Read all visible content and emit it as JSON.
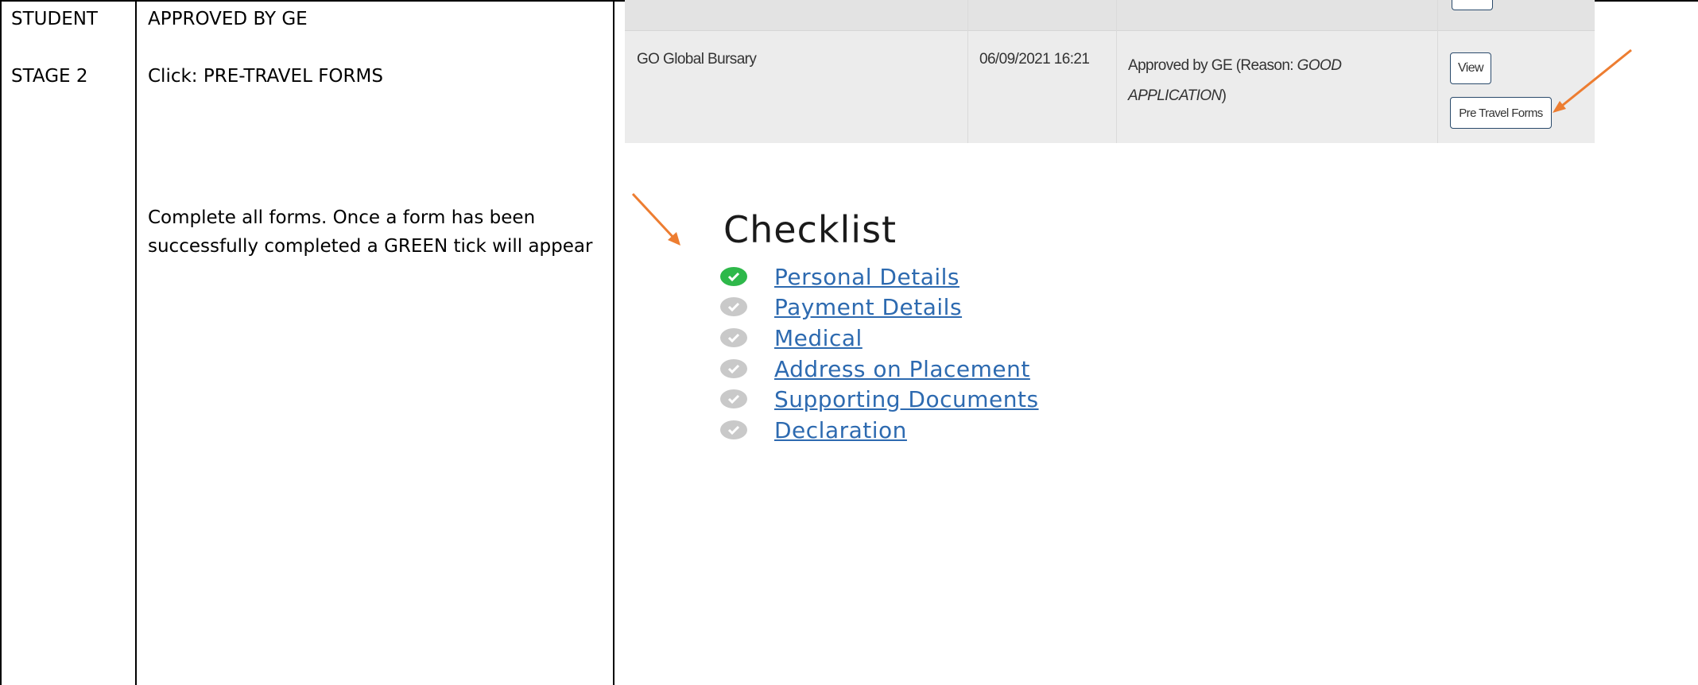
{
  "left_column": {
    "row1_label": "STUDENT",
    "row2_label": "STAGE 2"
  },
  "middle_column": {
    "row1_text": "APPROVED BY GE",
    "row2_text": "Click: PRE-TRAVEL FORMS",
    "instruction": "Complete all forms.  Once a form has been successfully completed a GREEN tick will appear"
  },
  "application_row": {
    "name": "GO Global Bursary",
    "datetime": "06/09/2021 16:21",
    "status_prefix": "Approved by GE (Reason: ",
    "status_reason_line1": "GOOD",
    "status_reason_line2": "APPLICATION",
    "status_suffix": ")",
    "view_label": "View",
    "pre_travel_label": "Pre Travel Forms"
  },
  "checklist": {
    "title": "Checklist",
    "items": [
      {
        "label": "Personal Details",
        "done": true
      },
      {
        "label": "Payment Details",
        "done": false
      },
      {
        "label": "Medical",
        "done": false
      },
      {
        "label": "Address on Placement",
        "done": false
      },
      {
        "label": "Supporting Documents",
        "done": false
      },
      {
        "label": "Declaration",
        "done": false
      }
    ]
  },
  "colors": {
    "arrow": "#ed7d31",
    "tick_done": "#2eb84a",
    "tick_pending": "#c9c9c9",
    "link": "#2d6ab0"
  }
}
